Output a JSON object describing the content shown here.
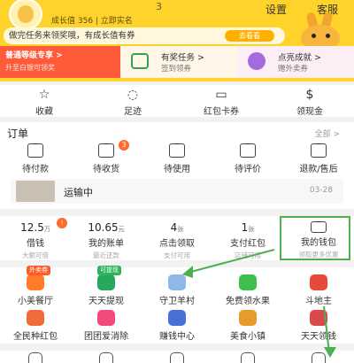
{
  "header": {
    "username": "3",
    "growth_text": "成长值 356 | 立即实名",
    "settings_label": "设置",
    "service_label": "客服",
    "task_text": "做完任务来领奖哦，有成长值有券",
    "task_button": "去看看"
  },
  "cards": [
    {
      "title": "普通等级专享 >",
      "subtitle": "升至白银可领奖",
      "icon": "crown-icon"
    },
    {
      "title": "有奖任务 >",
      "subtitle": "签到领券",
      "icon": "checklist-icon"
    },
    {
      "title": "点亮成就 >",
      "subtitle": "赠外卖券",
      "icon": "star-badge-icon"
    }
  ],
  "quick_actions": [
    {
      "label": "收藏",
      "icon": "star-icon"
    },
    {
      "label": "足迹",
      "icon": "footprint-icon"
    },
    {
      "label": "红包卡券",
      "icon": "coupon-icon"
    },
    {
      "label": "领现金",
      "icon": "cash-icon"
    }
  ],
  "orders": {
    "title": "订单",
    "all_label": "全部 >",
    "items": [
      {
        "label": "待付款",
        "icon": "wallet-card-icon"
      },
      {
        "label": "待收货",
        "icon": "truck-icon"
      },
      {
        "label": "待使用",
        "icon": "ticket-icon"
      },
      {
        "label": "待评价",
        "icon": "comment-icon"
      },
      {
        "label": "退款/售后",
        "icon": "refund-icon"
      }
    ],
    "badge_count": "3",
    "shipping_text": "运输中",
    "shipping_date": "03-28"
  },
  "wallet": {
    "badge": "!",
    "items": [
      {
        "value": "12.5",
        "unit": "万",
        "label": "借钱",
        "sub": "大额可借"
      },
      {
        "value": "10.65",
        "unit": "元",
        "label": "我的账单",
        "sub": "最近还款"
      },
      {
        "value": "4",
        "unit": "张",
        "label": "点击领取",
        "sub": "支付可用"
      },
      {
        "value": "1",
        "unit": "张",
        "label": "支付红包",
        "sub": "店铺可用"
      },
      {
        "value": "",
        "unit": "",
        "label": "我的钱包",
        "sub": "领取更多优惠"
      }
    ]
  },
  "services": {
    "row1": [
      {
        "label": "小美餐厅",
        "tag": "外卖券",
        "icon": "restaurant-icon",
        "color": "#ff7b2a"
      },
      {
        "label": "天天提现",
        "tag": "可提现",
        "icon": "cash-out-icon",
        "color": "#27a85a"
      },
      {
        "label": "守卫羊村",
        "tag": "",
        "icon": "sheep-icon",
        "color": "#8fb7e8"
      },
      {
        "label": "免费领水果",
        "tag": "",
        "icon": "fruit-icon",
        "color": "#3fbf4c"
      },
      {
        "label": "斗地主",
        "tag": "",
        "icon": "cards-icon",
        "color": "#e54b3a"
      }
    ],
    "row2": [
      {
        "label": "全民种红包",
        "icon": "plant-icon",
        "color": "#f26b3a"
      },
      {
        "label": "团团爱消除",
        "icon": "puzzle-icon",
        "color": "#f04b7a"
      },
      {
        "label": "赚钱中心",
        "icon": "coins-icon",
        "color": "#4a6fd8"
      },
      {
        "label": "美食小镇",
        "icon": "food-town-icon",
        "color": "#e89a2a"
      },
      {
        "label": "天天领钱",
        "icon": "money-bag-icon",
        "color": "#d94a4a"
      }
    ]
  },
  "colors": {
    "brand_yellow": "#ffd32a",
    "accent_orange": "#ff5b3a",
    "highlight_green": "#4caf50"
  }
}
